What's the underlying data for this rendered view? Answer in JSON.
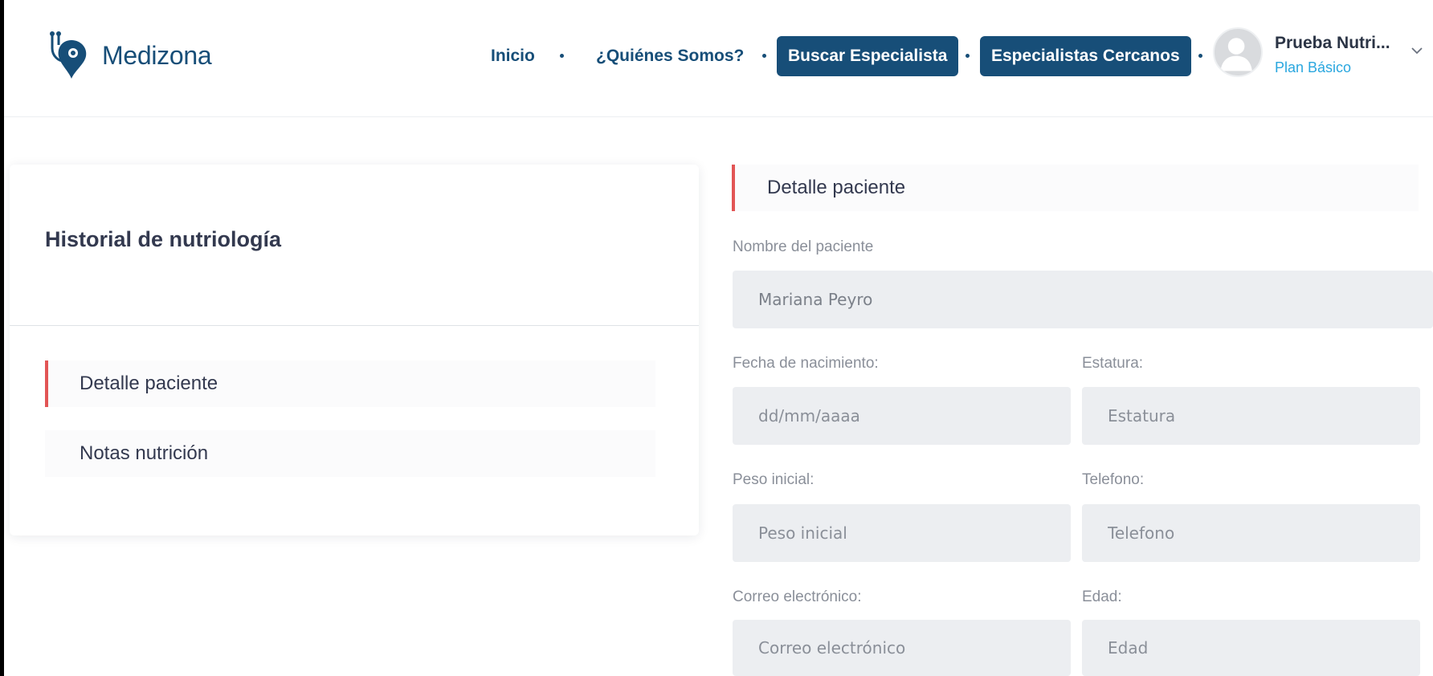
{
  "header": {
    "logo_text": "Medizona",
    "nav": {
      "inicio": "Inicio",
      "quienes": "¿Quiénes Somos?",
      "buscar": "Buscar Especialista",
      "cercanos": "Especialistas Cercanos"
    },
    "user": {
      "name": "Prueba Nutri...",
      "plan": "Plan Básico"
    }
  },
  "sidebar": {
    "title": "Historial de nutriología",
    "items": [
      {
        "label": "Detalle paciente",
        "active": true
      },
      {
        "label": "Notas nutrición",
        "active": false
      }
    ]
  },
  "form": {
    "section_title": "Detalle paciente",
    "nombre": {
      "label": "Nombre del paciente",
      "value": "Mariana Peyro"
    },
    "fecha": {
      "label": "Fecha de nacimiento:",
      "placeholder": "dd/mm/aaaa"
    },
    "estatura": {
      "label": "Estatura:",
      "placeholder": "Estatura"
    },
    "peso": {
      "label": "Peso inicial:",
      "placeholder": "Peso inicial"
    },
    "telefono": {
      "label": "Telefono:",
      "placeholder": "Telefono"
    },
    "correo": {
      "label": "Correo electrónico:",
      "placeholder": "Correo electrónico"
    },
    "edad": {
      "label": "Edad:",
      "placeholder": "Edad"
    }
  },
  "colors": {
    "brand": "#174e78",
    "accent_red": "#e25555",
    "plan_blue": "#2aa7df",
    "input_bg": "#eceef1"
  },
  "icons": [
    "stethoscope-pin-logo-icon",
    "user-avatar-icon",
    "chevron-down-icon"
  ]
}
